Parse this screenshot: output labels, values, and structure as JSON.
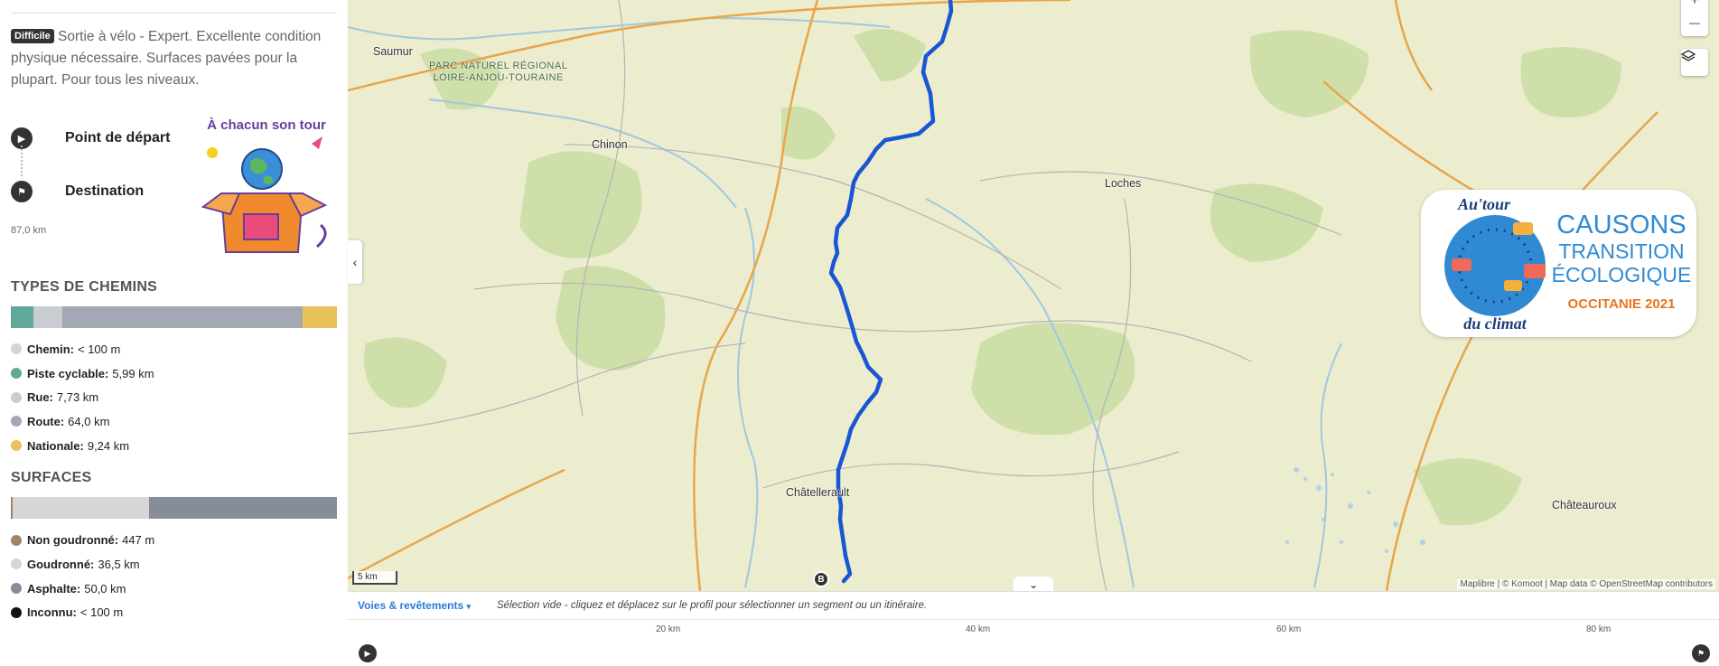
{
  "tour": {
    "badge": "Difficile",
    "description": "Sortie à vélo - Expert. Excellente condition physique nécessaire. Surfaces pavées pour la plupart. Pour tous les niveaux.",
    "start_label": "Point de départ",
    "destination_label": "Destination",
    "distance": "87,0 km",
    "illustration_text": "À chacun son tour"
  },
  "way_types": {
    "title": "TYPES DE CHEMINS",
    "segments": [
      {
        "color": "#5fa89a",
        "fraction": 0.069
      },
      {
        "color": "#c9ccd1",
        "fraction": 0.089
      },
      {
        "color": "#a2a9b4",
        "fraction": 0.736
      },
      {
        "color": "#e8c25a",
        "fraction": 0.106
      }
    ],
    "items": [
      {
        "name": "Chemin:",
        "value": "< 100 m",
        "color": "#d3d3d3"
      },
      {
        "name": "Piste cyclable:",
        "value": "5,99 km",
        "color": "#5fa89a"
      },
      {
        "name": "Rue:",
        "value": "7,73 km",
        "color": "#c9ccd1"
      },
      {
        "name": "Route:",
        "value": "64,0 km",
        "color": "#a2a9b4"
      },
      {
        "name": "Nationale:",
        "value": "9,24 km",
        "color": "#e8c25a"
      }
    ]
  },
  "surfaces": {
    "title": "SURFACES",
    "segments": [
      {
        "color": "#a08466",
        "fraction": 0.005
      },
      {
        "color": "#d6d6d6",
        "fraction": 0.42
      },
      {
        "color": "#868d99",
        "fraction": 0.575
      }
    ],
    "items": [
      {
        "name": "Non goudronné:",
        "value": "447 m",
        "color": "#a08466"
      },
      {
        "name": "Goudronné:",
        "value": "36,5 km",
        "color": "#d6d6d6"
      },
      {
        "name": "Asphalte:",
        "value": "50,0 km",
        "color": "#868d99"
      },
      {
        "name": "Inconnu:",
        "value": "< 100 m",
        "color": "#111111"
      }
    ]
  },
  "map": {
    "towns": {
      "saumur": "Saumur",
      "chinon": "Chinon",
      "loches": "Loches",
      "chatellerault": "Châtellerault",
      "chateauroux": "Châteauroux"
    },
    "park_line1": "PARC NATUREL RÉGIONAL",
    "park_line2": "LOIRE-ANJOU-TOURAINE",
    "scale": "5 km",
    "attribution": "Maplibre | © Komoot | Map data © OpenStreetMap contributors",
    "end_marker": "B",
    "zoom_in": "+",
    "zoom_out": "—",
    "route_color": "#1a55d4"
  },
  "logo": {
    "line1": "CAUSONS",
    "line2": "TRANSITION",
    "line3": "ÉCOLOGIQUE",
    "line4": "OCCITANIE 2021",
    "circle_top": "Au'tour",
    "circle_bottom": "du climat"
  },
  "profile": {
    "tab": "Voies & revêtements",
    "hint": "Sélection vide - cliquez et déplacez sur le profil pour sélectionner un segment ou un itinéraire.",
    "ticks": [
      "20 km",
      "40 km",
      "60 km",
      "80 km"
    ]
  }
}
